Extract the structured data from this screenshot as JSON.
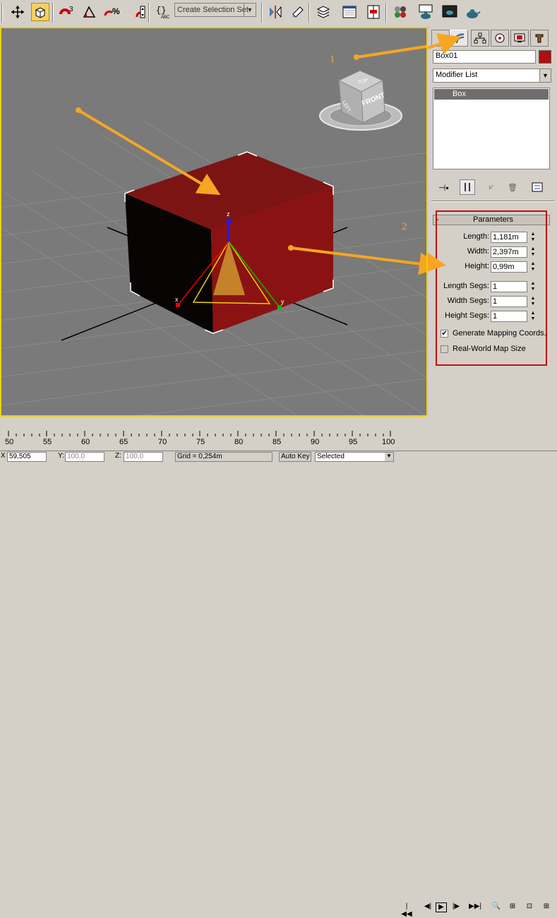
{
  "toolbar": {
    "selection_set_placeholder": "Create Selection Set",
    "snap_angle_label": "3",
    "percent_snap_label": "%",
    "icons": [
      "select-move-icon",
      "select-object-icon",
      "snap-toggle-icon",
      "angle-snap-icon",
      "percent-snap-icon",
      "spinner-snap-icon",
      "edit-named-selections-icon",
      "mirror-icon",
      "align-icon",
      "layer-manager-icon",
      "curve-editor-icon",
      "schematic-view-icon",
      "material-editor-icon",
      "render-setup-icon",
      "rendered-frame-icon",
      "quick-render-icon"
    ]
  },
  "viewport": {
    "viewcube_front": "FRONT",
    "viewcube_top": "TOP",
    "viewcube_left": "LEFT",
    "axis_x": "x",
    "axis_y": "y",
    "axis_z": "z",
    "annotation_1": "1",
    "annotation_2": "2",
    "box_color": "#8b1010"
  },
  "command_panel": {
    "tabs": [
      "create-icon",
      "modify-icon",
      "hierarchy-icon",
      "motion-icon",
      "display-icon",
      "utilities-icon"
    ],
    "object_name": "Box01",
    "object_color": "#b01010",
    "modifier_list_label": "Modifier List",
    "stack_items": [
      "Box"
    ],
    "rollout_title": "Parameters",
    "rollout_toggle": "-",
    "params": [
      {
        "label": "Length:",
        "value": "1,181m"
      },
      {
        "label": "Width:",
        "value": "2,397m"
      },
      {
        "label": "Height:",
        "value": "0,99m"
      },
      {
        "label": "Length Segs:",
        "value": "1"
      },
      {
        "label": "Width Segs:",
        "value": "1"
      },
      {
        "label": "Height Segs:",
        "value": "1"
      }
    ],
    "generate_mapping": {
      "label": "Generate Mapping Coords.",
      "checked": true,
      "mark": "✔"
    },
    "real_world": {
      "label": "Real-World Map Size",
      "checked": false
    }
  },
  "timeline": {
    "ticks": [
      "50",
      "55",
      "60",
      "65",
      "70",
      "75",
      "80",
      "85",
      "90",
      "95",
      "100"
    ]
  },
  "statusbar": {
    "x_label": "X",
    "x_value": "59,505",
    "y_label": "Y:",
    "y_value": "100,0",
    "z_label": "Z:",
    "z_value": "100,0",
    "grid_label": "Grid = 0,254m",
    "auto_key_label": "Auto Key",
    "selected_value": "Selected"
  }
}
